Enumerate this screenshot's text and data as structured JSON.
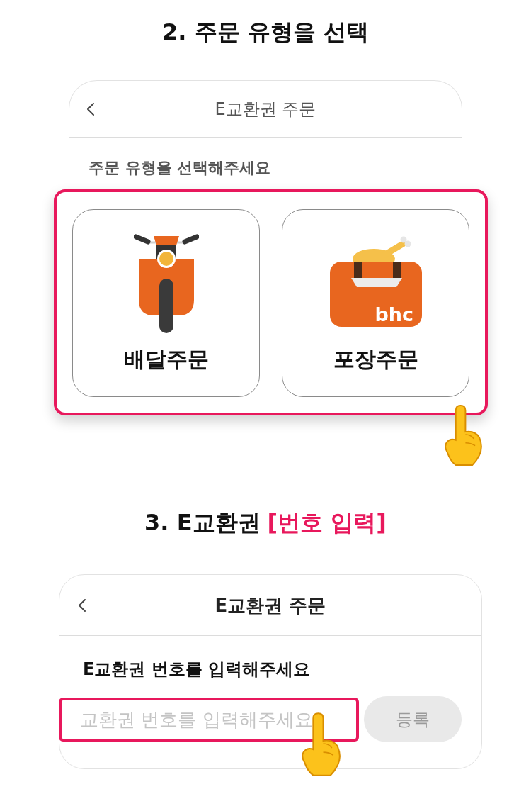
{
  "order_type_step": {
    "heading": "2. 주문 유형을 선택",
    "screen": {
      "title": "E교환권 주문",
      "prompt": "주문 유형을 선택해주세요",
      "highlighted": true,
      "options": [
        {
          "kind": "delivery",
          "label": "배달주문"
        },
        {
          "kind": "takeout",
          "label": "포장주문",
          "logo_text": "bhc"
        }
      ]
    }
  },
  "voucher_step": {
    "heading": "3. E교환권",
    "heading_accent": "[번호 입력]",
    "screen": {
      "title": "E교환권 주문",
      "prompt": "E교환권 번호를 입력해주세요",
      "input": {
        "placeholder": "교환권 번호를 입력해주세요",
        "highlighted": true
      },
      "register_button": {
        "label": "등록",
        "disabled": true
      }
    }
  }
}
